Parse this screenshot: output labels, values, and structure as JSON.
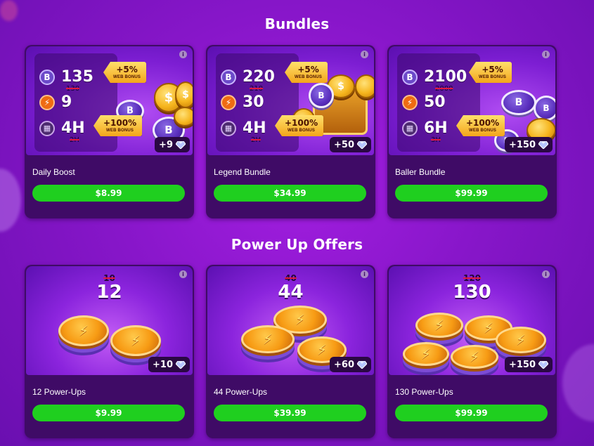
{
  "sections": {
    "bundles_title": "Bundles",
    "powerups_title": "Power Up Offers"
  },
  "bundles": [
    {
      "name": "Daily Boost",
      "coins": "135",
      "coins_old": "130",
      "power": "9",
      "time": "4H",
      "time_old": "2H",
      "coin_bonus_pct": "+5%",
      "coin_bonus_label": "WEB BONUS",
      "time_bonus_pct": "+100%",
      "time_bonus_label": "WEB BONUS",
      "gems": "+9",
      "price": "$8.99"
    },
    {
      "name": "Legend Bundle",
      "coins": "220",
      "coins_old": "210",
      "power": "30",
      "time": "4H",
      "time_old": "2H",
      "coin_bonus_pct": "+5%",
      "coin_bonus_label": "WEB BONUS",
      "time_bonus_pct": "+100%",
      "time_bonus_label": "WEB BONUS",
      "gems": "+50",
      "price": "$34.99"
    },
    {
      "name": "Baller Bundle",
      "coins": "2100",
      "coins_old": "2000",
      "power": "50",
      "time": "6H",
      "time_old": "3H",
      "coin_bonus_pct": "+5%",
      "coin_bonus_label": "WEB BONUS",
      "time_bonus_pct": "+100%",
      "time_bonus_label": "WEB BONUS",
      "gems": "+150",
      "price": "$99.99"
    }
  ],
  "powerups": [
    {
      "name": "12 Power-Ups",
      "old_count": "10",
      "count": "12",
      "gems": "+10",
      "price": "$9.99"
    },
    {
      "name": "44 Power-Ups",
      "old_count": "40",
      "count": "44",
      "gems": "+60",
      "price": "$39.99"
    },
    {
      "name": "130 Power-Ups",
      "old_count": "120",
      "count": "130",
      "gems": "+150",
      "price": "$99.99"
    }
  ],
  "glyphs": {
    "b_coin": "B",
    "bolt": "⚡",
    "grid": "▦",
    "info": "i",
    "dollar": "$"
  },
  "colors": {
    "background": "#8716c9",
    "card": "#3f0b66",
    "buy_button": "#1fcf1f",
    "bonus_tag": "#f3a51b",
    "strike": "#e0193e"
  }
}
